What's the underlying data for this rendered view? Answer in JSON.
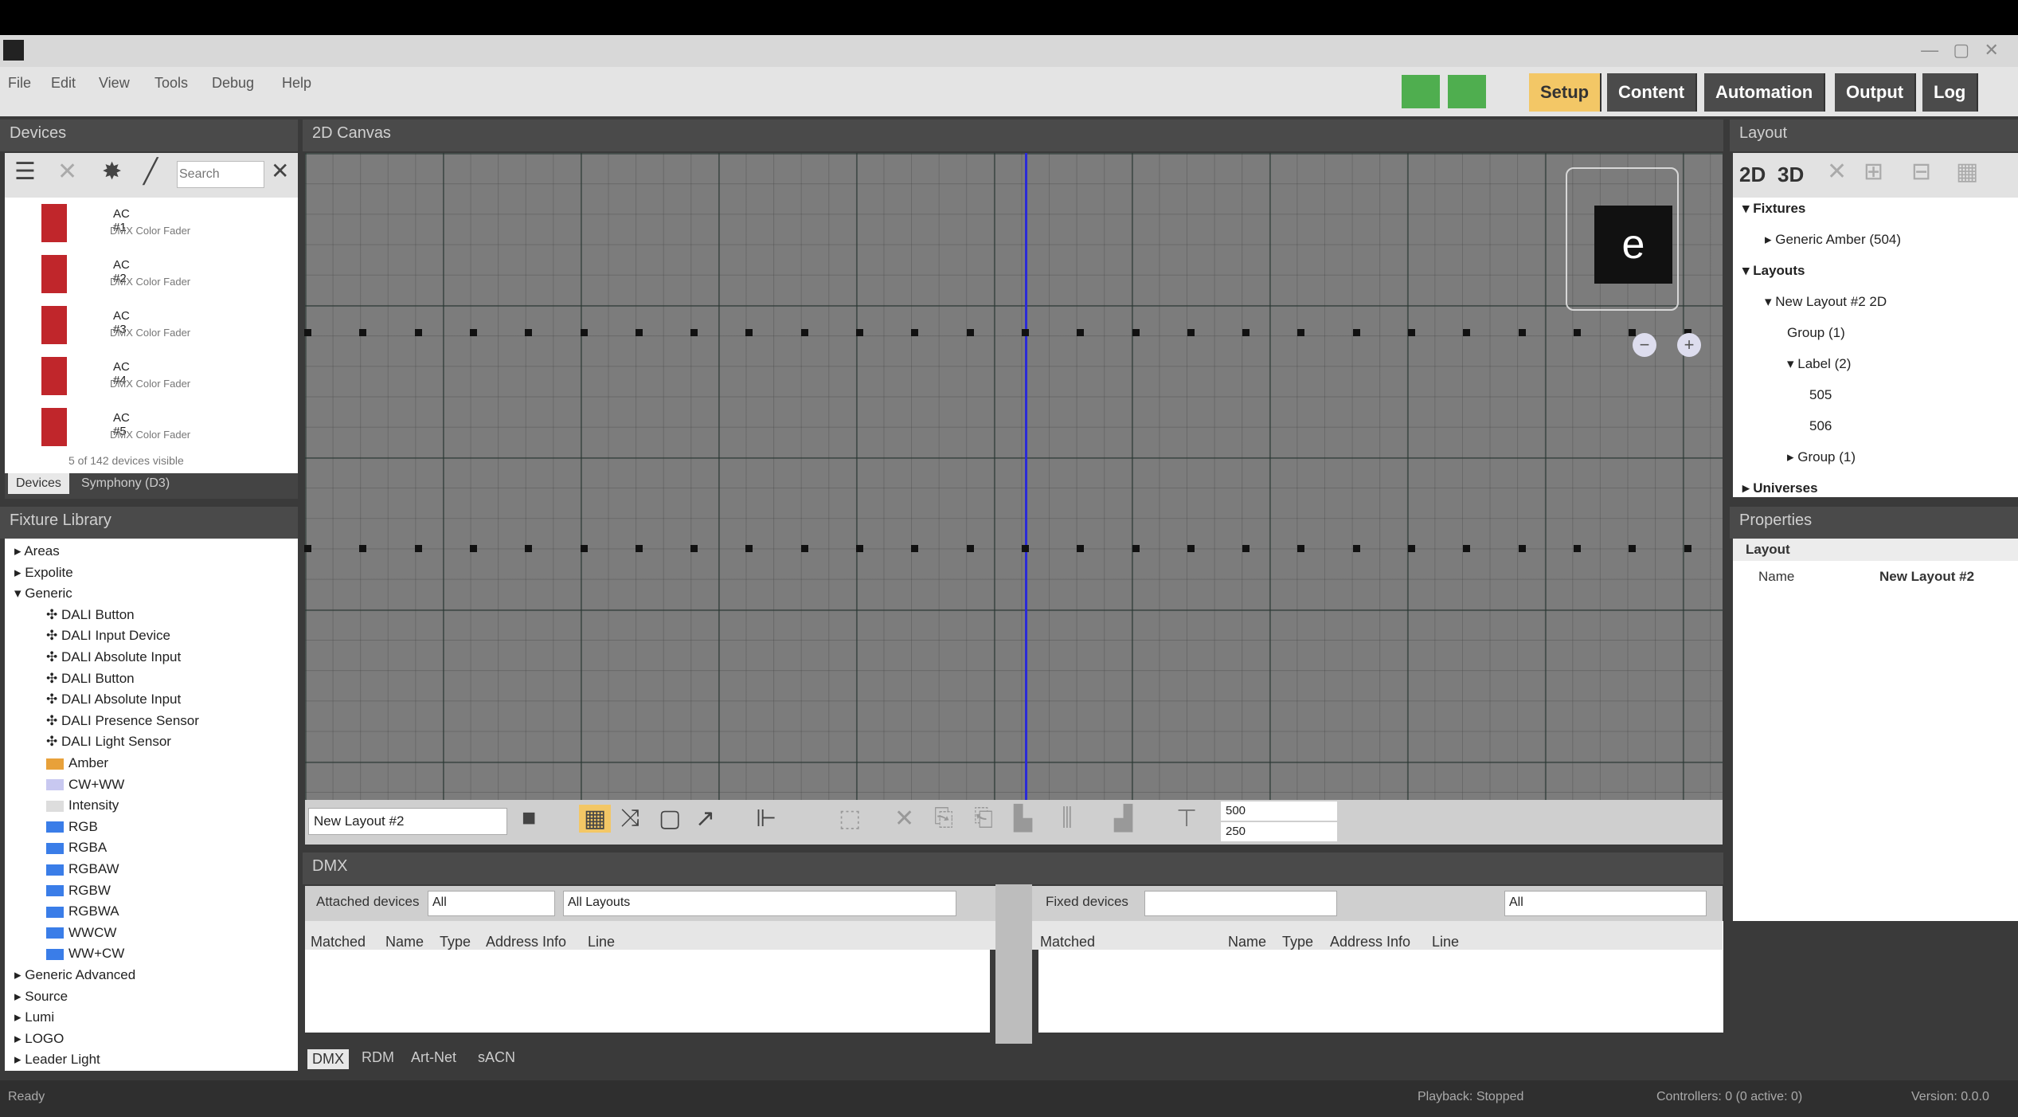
{
  "menu": [
    "File",
    "Edit",
    "View",
    "Tools",
    "Debug",
    "Help"
  ],
  "top_tabs": [
    "Setup",
    "Content",
    "Automation",
    "Output",
    "Log"
  ],
  "panels": {
    "devices": "Devices",
    "canvas": "2D Canvas",
    "layout": "Layout",
    "fixture_library": "Fixture Library",
    "properties": "Properties",
    "dmx": "DMX"
  },
  "devices": {
    "search_placeholder": "Search",
    "items": [
      {
        "name": "AC #1",
        "desc": "DMX Color Fader"
      },
      {
        "name": "AC #2",
        "desc": "DMX Color Fader"
      },
      {
        "name": "AC #3",
        "desc": "DMX Color Fader"
      },
      {
        "name": "AC #4",
        "desc": "DMX Color Fader"
      },
      {
        "name": "AC #5",
        "desc": "DMX Color Fader"
      }
    ],
    "footer": "5 of 142 devices visible",
    "tabs": [
      "Devices",
      "Symphony (D3)"
    ]
  },
  "fixture_tree": [
    {
      "label": "Areas",
      "indent": 0,
      "expander": "▸"
    },
    {
      "label": "Expolite",
      "indent": 0,
      "expander": "▸"
    },
    {
      "label": "Generic",
      "indent": 0,
      "expander": "▾"
    },
    {
      "label": "DALI Button",
      "indent": 1
    },
    {
      "label": "DALI Input Device",
      "indent": 1
    },
    {
      "label": "DALI Absolute Input",
      "indent": 1
    },
    {
      "label": "DALI Button",
      "indent": 1
    },
    {
      "label": "DALI Absolute Input",
      "indent": 1
    },
    {
      "label": "DALI Presence Sensor",
      "indent": 1
    },
    {
      "label": "DALI Light Sensor",
      "indent": 1
    },
    {
      "label": "Amber",
      "indent": 1
    },
    {
      "label": "CW+WW",
      "indent": 1
    },
    {
      "label": "Intensity",
      "indent": 1
    },
    {
      "label": "RGB",
      "indent": 1
    },
    {
      "label": "RGBA",
      "indent": 1
    },
    {
      "label": "RGBAW",
      "indent": 1
    },
    {
      "label": "RGBW",
      "indent": 1
    },
    {
      "label": "RGBWA",
      "indent": 1
    },
    {
      "label": "WWCW",
      "indent": 1
    },
    {
      "label": "WW+CW",
      "indent": 1
    },
    {
      "label": "Generic Advanced",
      "indent": 0,
      "expander": "▸"
    },
    {
      "label": "Source",
      "indent": 0,
      "expander": "▸"
    },
    {
      "label": "Lumi",
      "indent": 0,
      "expander": "▸"
    },
    {
      "label": "LOGO",
      "indent": 0,
      "expander": "▸"
    },
    {
      "label": "Leader Light",
      "indent": 0,
      "expander": "▸"
    }
  ],
  "canvas": {
    "layout_select": "New Layout #2",
    "coord_x": "500",
    "coord_y": "250",
    "logo_text": "e"
  },
  "layout_tree": {
    "tabs": [
      "2D",
      "3D"
    ],
    "items": [
      {
        "label": "Fixtures",
        "indent": 0,
        "expander": "▾"
      },
      {
        "label": "Generic Amber (504)",
        "indent": 1,
        "expander": "▸"
      },
      {
        "label": "Layouts",
        "indent": 0,
        "expander": "▾"
      },
      {
        "label": "New Layout #2 2D",
        "indent": 1,
        "expander": "▾"
      },
      {
        "label": "Group (1)",
        "indent": 2
      },
      {
        "label": "Label (2)",
        "indent": 2,
        "expander": "▾"
      },
      {
        "label": "505",
        "indent": 3
      },
      {
        "label": "506",
        "indent": 3
      },
      {
        "label": "Group (1)",
        "indent": 2,
        "expander": "▸"
      },
      {
        "label": "Universes",
        "indent": 0,
        "expander": "▸"
      }
    ]
  },
  "properties": {
    "section": "Layout",
    "name_label": "Name",
    "name_value": "New Layout #2"
  },
  "dmx": {
    "filter_label": "Attached devices",
    "filter_value": "All",
    "layouts_value": "All Layouts",
    "right_filter_label": "Fixed devices",
    "right_dropdown": "All",
    "left_cols": [
      "Matched",
      "Name",
      "Type",
      "Address Info",
      "Line"
    ],
    "right_cols": [
      "Matched",
      "Name",
      "Type",
      "Address Info",
      "Line"
    ],
    "bottom_tabs": [
      "DMX",
      "RDM",
      "Art-Net",
      "sACN"
    ]
  },
  "status": {
    "left": "Ready",
    "mid": "Playback: Stopped",
    "right": "Controllers: 0 (0 active: 0)",
    "far": "Version: 0.0.0"
  }
}
